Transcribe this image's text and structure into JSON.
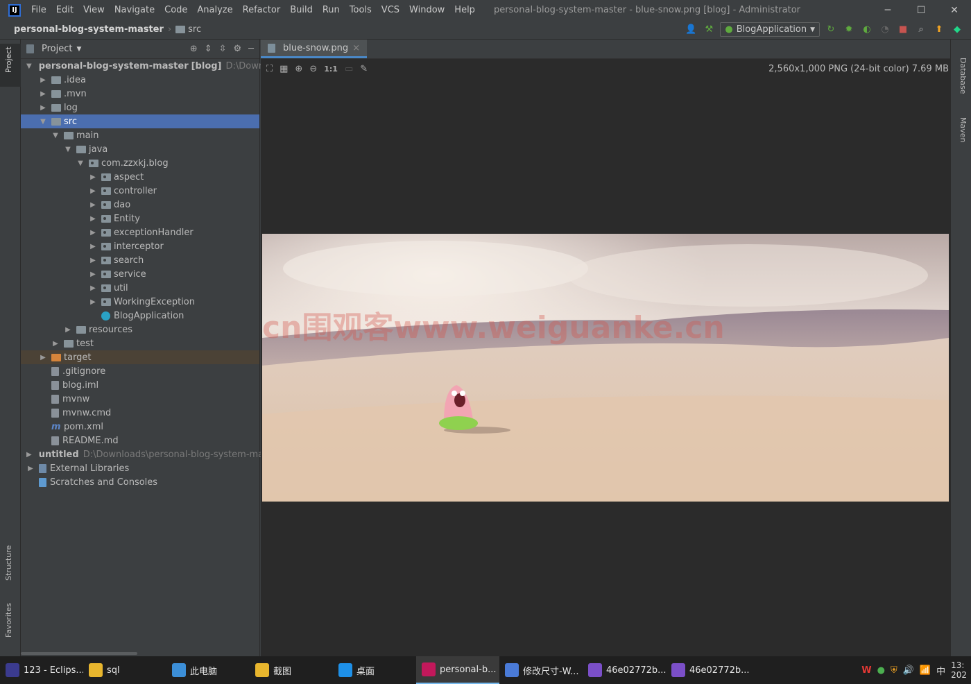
{
  "titlebar": {
    "logo": "IJ",
    "menu": [
      "File",
      "Edit",
      "View",
      "Navigate",
      "Code",
      "Analyze",
      "Refactor",
      "Build",
      "Run",
      "Tools",
      "VCS",
      "Window",
      "Help"
    ],
    "window_title": "personal-blog-system-master - blue-snow.png [blog] - Administrator",
    "controls": {
      "minimize": "─",
      "maximize": "☐",
      "close": "✕"
    }
  },
  "navbar": {
    "project": "personal-blog-system-master",
    "folder": "src",
    "run_config": "BlogApplication"
  },
  "left_strip": {
    "project": "Project",
    "structure": "Structure",
    "favorites": "Favorites"
  },
  "right_strip": {
    "database": "Database",
    "maven": "Maven"
  },
  "project_panel": {
    "title": "Project",
    "tree": [
      {
        "label": "personal-blog-system-master",
        "suffix": "[blog]",
        "hint": "D:\\Downloads",
        "depth": 0,
        "type": "module",
        "expanded": true
      },
      {
        "label": ".idea",
        "depth": 1,
        "type": "folder"
      },
      {
        "label": ".mvn",
        "depth": 1,
        "type": "folder"
      },
      {
        "label": "log",
        "depth": 1,
        "type": "folder"
      },
      {
        "label": "src",
        "depth": 1,
        "type": "folder",
        "expanded": true,
        "selected": true
      },
      {
        "label": "main",
        "depth": 2,
        "type": "folder",
        "expanded": true
      },
      {
        "label": "java",
        "depth": 3,
        "type": "folder",
        "expanded": true
      },
      {
        "label": "com.zzxkj.blog",
        "depth": 4,
        "type": "package",
        "expanded": true
      },
      {
        "label": "aspect",
        "depth": 5,
        "type": "package"
      },
      {
        "label": "controller",
        "depth": 5,
        "type": "package"
      },
      {
        "label": "dao",
        "depth": 5,
        "type": "package"
      },
      {
        "label": "Entity",
        "depth": 5,
        "type": "package"
      },
      {
        "label": "exceptionHandler",
        "depth": 5,
        "type": "package"
      },
      {
        "label": "interceptor",
        "depth": 5,
        "type": "package"
      },
      {
        "label": "search",
        "depth": 5,
        "type": "package"
      },
      {
        "label": "service",
        "depth": 5,
        "type": "package"
      },
      {
        "label": "util",
        "depth": 5,
        "type": "package"
      },
      {
        "label": "WorkingException",
        "depth": 5,
        "type": "package"
      },
      {
        "label": "BlogApplication",
        "depth": 5,
        "type": "class",
        "leaf": true
      },
      {
        "label": "resources",
        "depth": 3,
        "type": "resources"
      },
      {
        "label": "test",
        "depth": 2,
        "type": "folder"
      },
      {
        "label": "target",
        "depth": 1,
        "type": "excluded"
      },
      {
        "label": ".gitignore",
        "depth": 1,
        "type": "file",
        "leaf": true
      },
      {
        "label": "blog.iml",
        "depth": 1,
        "type": "file",
        "leaf": true
      },
      {
        "label": "mvnw",
        "depth": 1,
        "type": "file",
        "leaf": true
      },
      {
        "label": "mvnw.cmd",
        "depth": 1,
        "type": "file",
        "leaf": true
      },
      {
        "label": "pom.xml",
        "depth": 1,
        "type": "maven",
        "leaf": true
      },
      {
        "label": "README.md",
        "depth": 1,
        "type": "file",
        "leaf": true
      },
      {
        "label": "untitled",
        "hint": "D:\\Downloads\\personal-blog-system-mast",
        "depth": 0,
        "type": "module",
        "bold": true
      },
      {
        "label": "External Libraries",
        "depth": 0,
        "type": "libs"
      },
      {
        "label": "Scratches and Consoles",
        "depth": 0,
        "type": "scratch",
        "leaf": true
      }
    ]
  },
  "editor": {
    "tab": "blue-snow.png",
    "tab_close": "×",
    "image_info": "2,560x1,000 PNG (24-bit color) 7.69 MB",
    "zoom_actual": "1:1",
    "watermark": "cn围观客www.weiguanke.cn"
  },
  "taskbar": {
    "items": [
      {
        "label": "123 - Eclips...",
        "color": "#3b3b8f"
      },
      {
        "label": "sql",
        "color": "#e8b62e"
      },
      {
        "label": "此电脑",
        "color": "#3c8fd8"
      },
      {
        "label": "截图",
        "color": "#e8b62e"
      },
      {
        "label": "桌面",
        "color": "#1e90e8"
      },
      {
        "label": "personal-b...",
        "color": "#c2185b",
        "active": true
      },
      {
        "label": "修改尺寸-W...",
        "color": "#4a7bd8"
      },
      {
        "label": "46e02772b...",
        "color": "#7b4fc8"
      },
      {
        "label": "46e02772b...",
        "color": "#7b4fc8"
      }
    ],
    "ime": "中",
    "clock": "13:",
    "date": "202"
  }
}
